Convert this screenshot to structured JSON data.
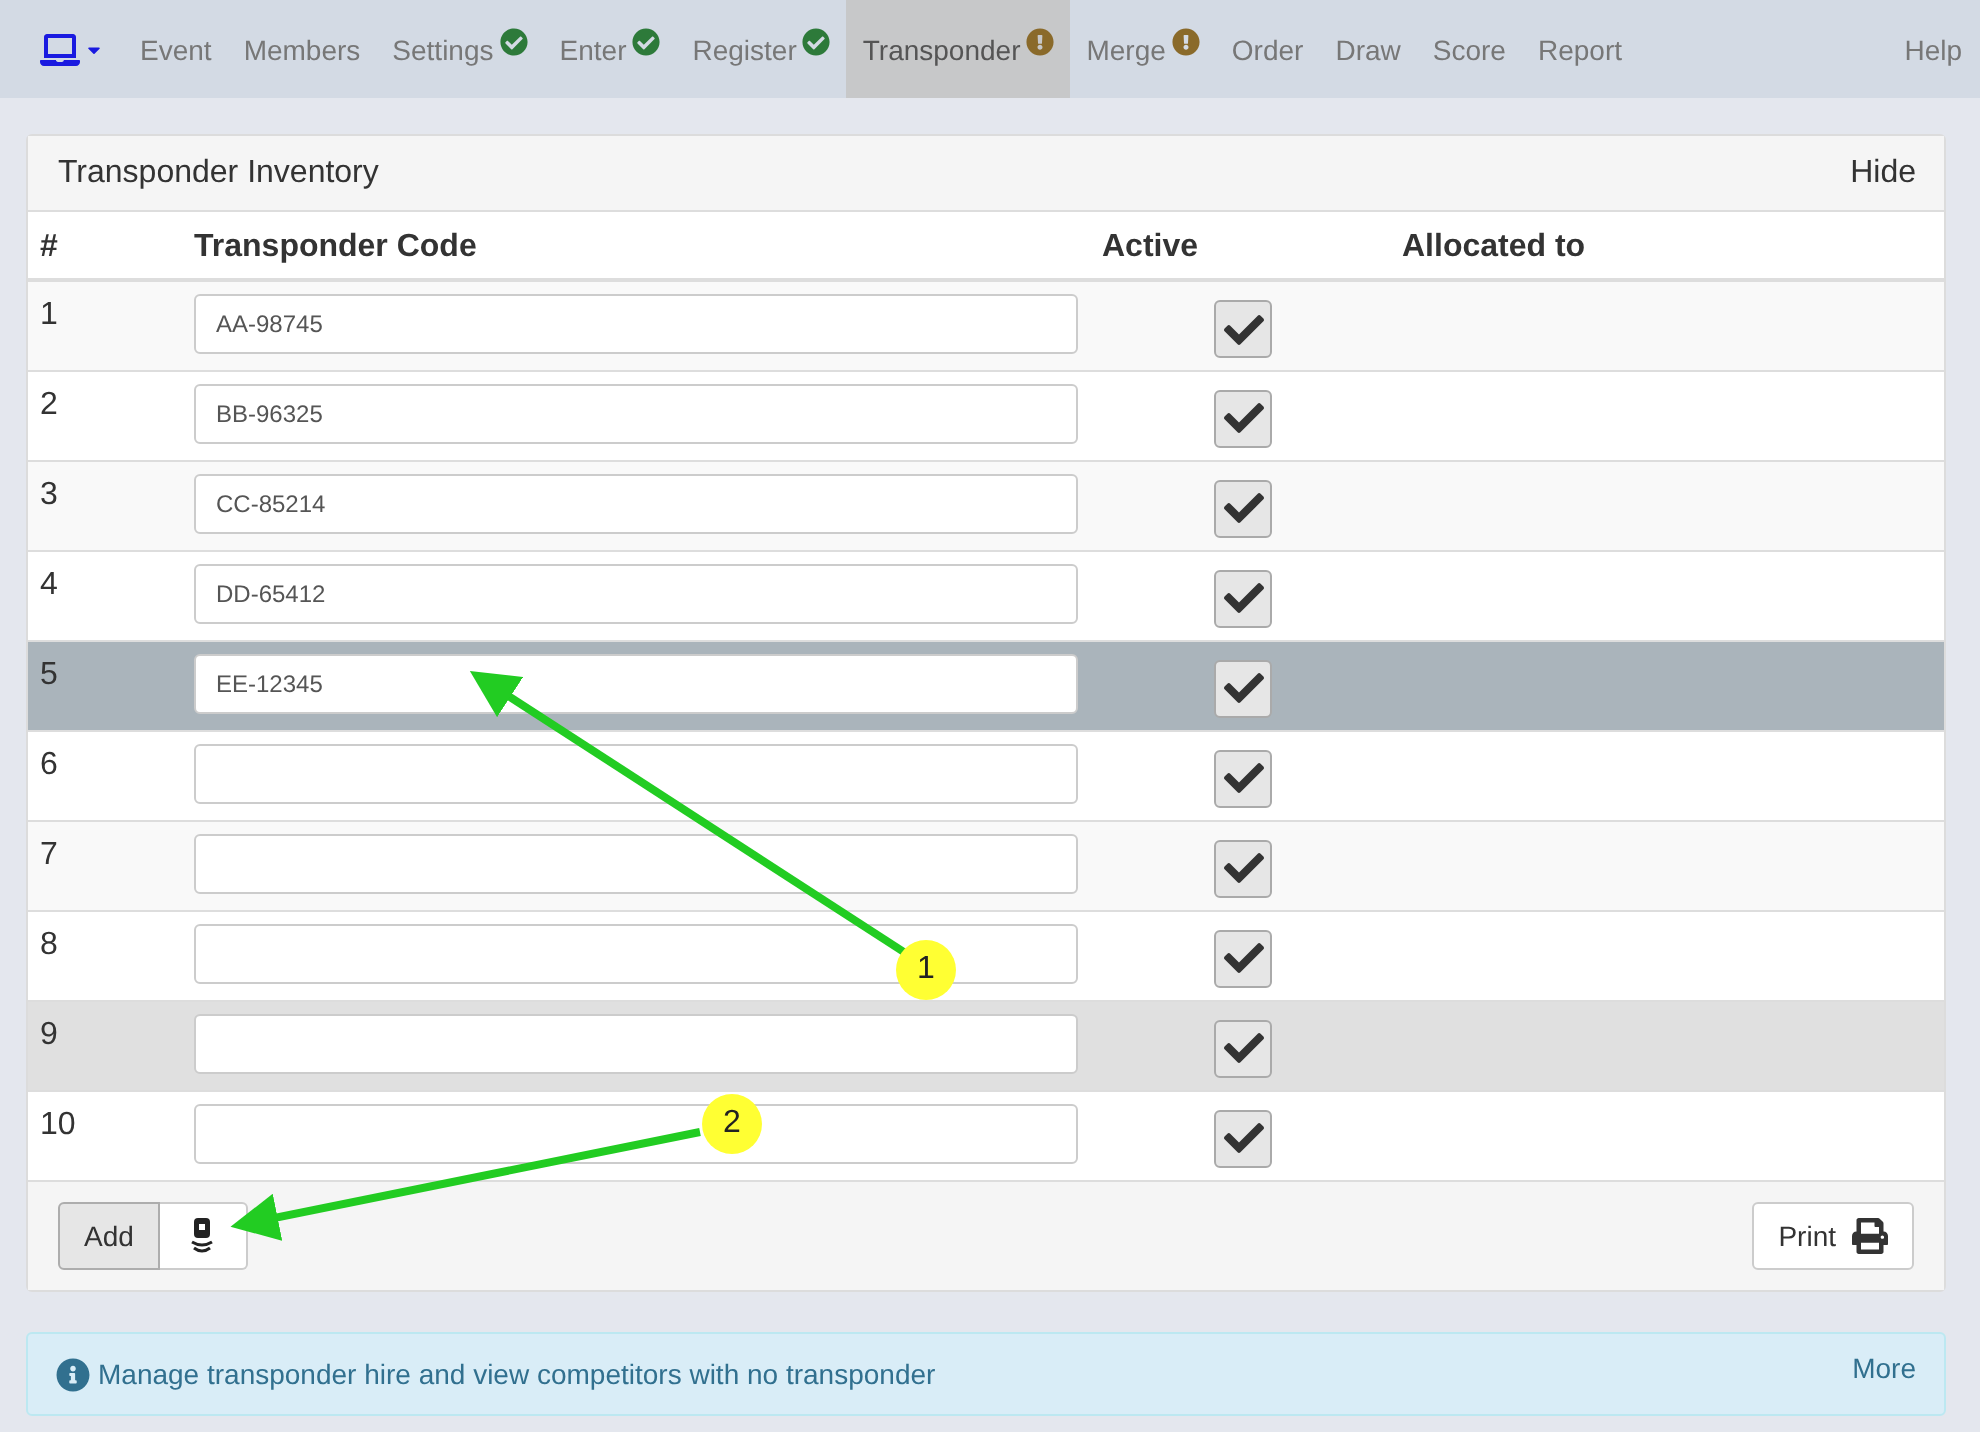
{
  "nav": {
    "items": [
      {
        "label": "Event",
        "done": false,
        "warning": false,
        "selected": false
      },
      {
        "label": "Members",
        "done": false,
        "warning": false,
        "selected": false
      },
      {
        "label": "Settings",
        "done": true,
        "warning": false,
        "selected": false
      },
      {
        "label": "Enter",
        "done": true,
        "warning": false,
        "selected": false
      },
      {
        "label": "Register",
        "done": true,
        "warning": false,
        "selected": false
      },
      {
        "label": "Transponder",
        "done": false,
        "warning": true,
        "selected": true
      },
      {
        "label": "Merge",
        "done": false,
        "warning": true,
        "selected": false
      },
      {
        "label": "Order",
        "done": false,
        "warning": false,
        "selected": false
      },
      {
        "label": "Draw",
        "done": false,
        "warning": false,
        "selected": false
      },
      {
        "label": "Score",
        "done": false,
        "warning": false,
        "selected": false
      },
      {
        "label": "Report",
        "done": false,
        "warning": false,
        "selected": false
      }
    ],
    "help": "Help"
  },
  "panel": {
    "title": "Transponder Inventory",
    "hide": "Hide",
    "columns": [
      "#",
      "Transponder Code",
      "Active",
      "Allocated to"
    ],
    "rows": [
      {
        "number": "1",
        "code": "AA-98745",
        "active": true,
        "selected": false,
        "hovered": false
      },
      {
        "number": "2",
        "code": "BB-96325",
        "active": true,
        "selected": false,
        "hovered": false
      },
      {
        "number": "3",
        "code": "CC-85214",
        "active": true,
        "selected": false,
        "hovered": false
      },
      {
        "number": "4",
        "code": "DD-65412",
        "active": true,
        "selected": false,
        "hovered": false
      },
      {
        "number": "5",
        "code": "EE-12345",
        "active": true,
        "selected": true,
        "hovered": false
      },
      {
        "number": "6",
        "active": true,
        "selected": false,
        "hovered": false
      },
      {
        "number": "7",
        "active": true,
        "selected": false,
        "hovered": false
      },
      {
        "number": "8",
        "active": true,
        "selected": false,
        "hovered": false
      },
      {
        "number": "9",
        "active": true,
        "selected": false,
        "hovered": true
      },
      {
        "number": "10",
        "active": true,
        "selected": false,
        "hovered": false
      }
    ],
    "add": "Add",
    "print": "Print"
  },
  "info": {
    "text": "Manage transponder hire and view competitors with no transponder",
    "more": "More"
  },
  "annotations": [
    {
      "label": "1"
    },
    {
      "label": "2"
    }
  ]
}
